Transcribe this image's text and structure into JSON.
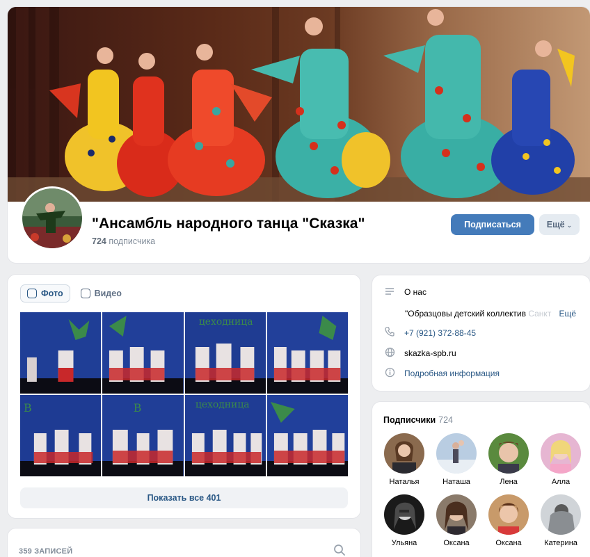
{
  "header": {
    "title": "\"Ансамбль народного танца \"Сказка\"",
    "subscribers_count": "724",
    "subscribers_word": "подписчика",
    "subscribe_label": "Подписаться",
    "more_label": "Ещё"
  },
  "media": {
    "tabs": [
      {
        "label": "Фото",
        "active": true
      },
      {
        "label": "Видео",
        "active": false
      }
    ],
    "show_all_label": "Показать все 401"
  },
  "posts": {
    "count_label": "359 ЗАПИСЕЙ"
  },
  "info": {
    "about_label": "О нас",
    "description_visible": "\"Образцовы детский коллектив ",
    "description_faded": "Санкт",
    "description_more": "Ещё",
    "phone": "+7 (921) 372-88-45",
    "website": "skazka-spb.ru",
    "details_label": "Подробная информация"
  },
  "followers": {
    "title": "Подписчики",
    "count": "724",
    "items": [
      {
        "name": "Наталья"
      },
      {
        "name": "Наташа"
      },
      {
        "name": "Лена"
      },
      {
        "name": "Алла"
      },
      {
        "name": "Ульяна"
      },
      {
        "name": "Оксана"
      },
      {
        "name": "Оксана"
      },
      {
        "name": "Катерина"
      }
    ]
  },
  "colors": {
    "accent": "#447bba",
    "link": "#2a5885",
    "background": "#edeef0",
    "muted": "#818c99"
  },
  "icons": {
    "about": "lines-icon",
    "phone": "phone-icon",
    "website": "globe-icon",
    "details": "info-icon",
    "search": "search-icon"
  }
}
